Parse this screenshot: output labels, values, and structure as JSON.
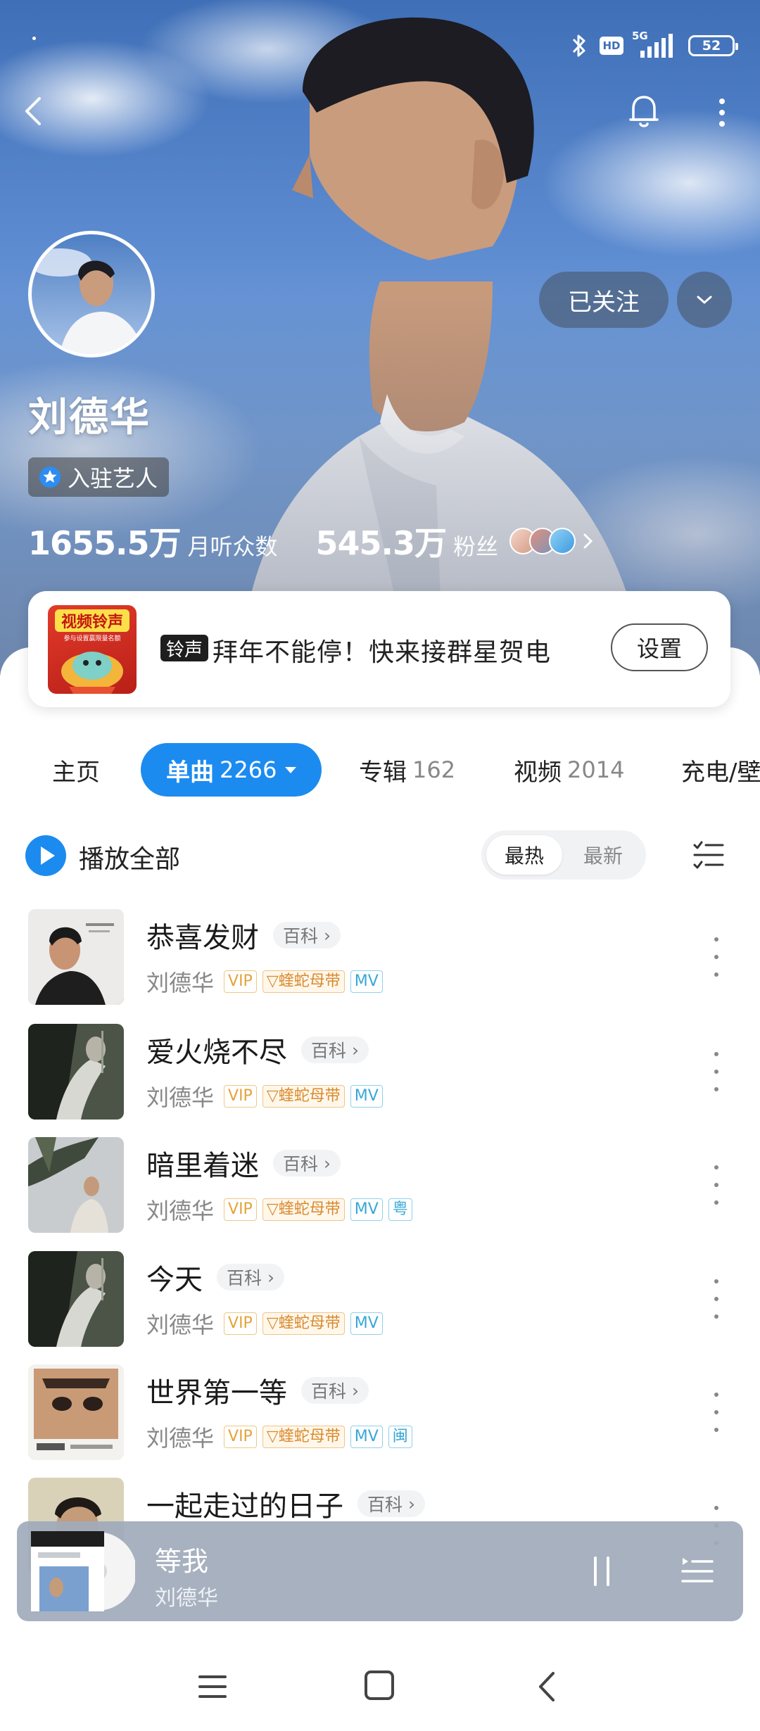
{
  "status_bar": {
    "network": "5G",
    "hd": "HD",
    "battery": "52"
  },
  "artist": {
    "name": "刘德华",
    "badge": "入驻艺人",
    "monthly_listeners_value": "1655.5万",
    "monthly_listeners_label": "月听众数",
    "fans_value": "545.3万",
    "fans_label": "粉丝",
    "follow_label": "已关注"
  },
  "promo": {
    "thumb_title": "视频铃声",
    "thumb_sub": "参与设置赢限量名额",
    "tag": "铃声",
    "text": "拜年不能停！快来接群星贺电",
    "button": "设置"
  },
  "tabs": [
    {
      "label": "主页",
      "count": ""
    },
    {
      "label": "单曲",
      "count": "2266",
      "active": true
    },
    {
      "label": "专辑",
      "count": "162"
    },
    {
      "label": "视频",
      "count": "2014"
    },
    {
      "label": "充电/壁",
      "count": ""
    }
  ],
  "play_all": "播放全部",
  "sort": {
    "hot": "最热",
    "new": "最新"
  },
  "songs": [
    {
      "title": "恭喜发财",
      "baike": "百科",
      "singer": "刘德华",
      "vip": "VIP",
      "master": "蝰蛇母带",
      "mv": "MV",
      "lang": ""
    },
    {
      "title": "爱火烧不尽",
      "baike": "百科",
      "singer": "刘德华",
      "vip": "VIP",
      "master": "蝰蛇母带",
      "mv": "MV",
      "lang": ""
    },
    {
      "title": "暗里着迷",
      "baike": "百科",
      "singer": "刘德华",
      "vip": "VIP",
      "master": "蝰蛇母带",
      "mv": "MV",
      "lang": "粤"
    },
    {
      "title": "今天",
      "baike": "百科",
      "singer": "刘德华",
      "vip": "VIP",
      "master": "蝰蛇母带",
      "mv": "MV",
      "lang": ""
    },
    {
      "title": "世界第一等",
      "baike": "百科",
      "singer": "刘德华",
      "vip": "VIP",
      "master": "蝰蛇母带",
      "mv": "MV",
      "lang": "闽"
    },
    {
      "title": "一起走过的日子",
      "baike": "百科",
      "singer": "",
      "vip": "",
      "master": "",
      "mv": "",
      "lang": ""
    }
  ],
  "now_playing": {
    "title": "等我",
    "artist": "刘德华"
  },
  "colors": {
    "accent": "#1c8bf0",
    "vip": "#e3a33a",
    "mv": "#37a8d6"
  }
}
